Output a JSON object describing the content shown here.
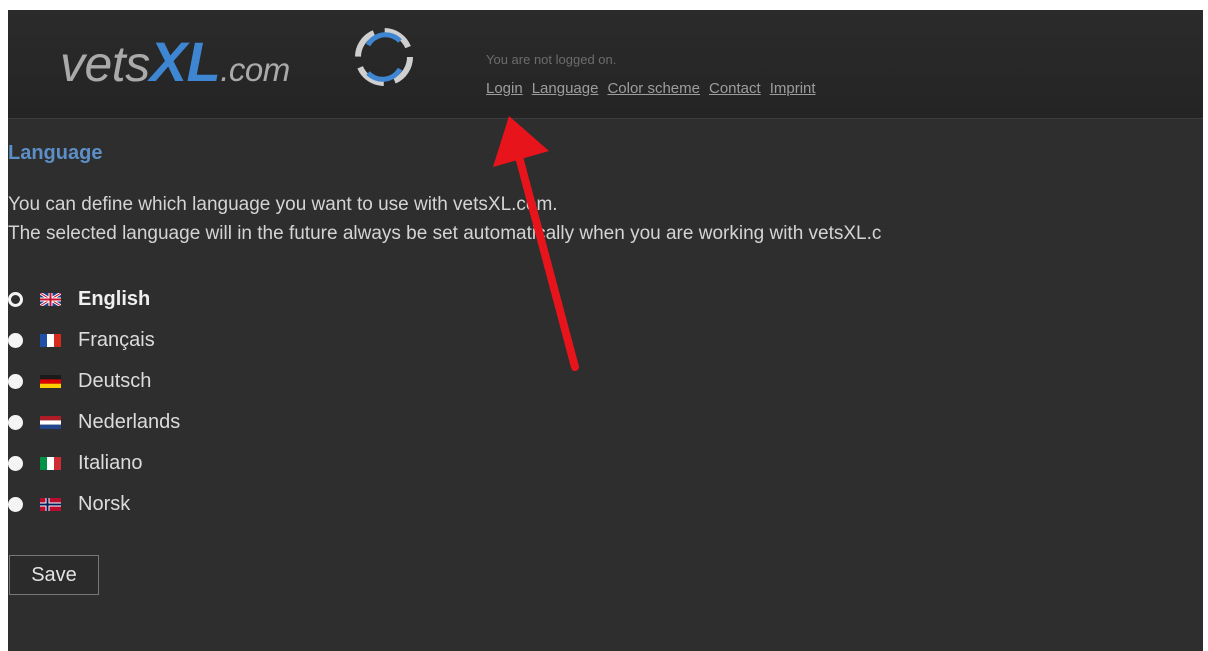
{
  "header": {
    "logo": {
      "part1": "vets",
      "part2": "XL",
      "part3": ".com"
    },
    "status": "You are not logged on.",
    "nav": [
      "Login",
      "Language",
      "Color scheme",
      "Contact",
      "Imprint"
    ]
  },
  "page": {
    "title": "Language",
    "intro_line1": "You can define which language you want to use with vetsXL.com.",
    "intro_line2": "The selected language will in the future always be set automatically when you are working with vetsXL.c"
  },
  "languages": [
    {
      "label": "English",
      "selected": true,
      "flag": "uk-flag-icon"
    },
    {
      "label": "Français",
      "selected": false,
      "flag": "france-flag-icon"
    },
    {
      "label": "Deutsch",
      "selected": false,
      "flag": "germany-flag-icon"
    },
    {
      "label": "Nederlands",
      "selected": false,
      "flag": "netherlands-flag-icon"
    },
    {
      "label": "Italiano",
      "selected": false,
      "flag": "italy-flag-icon"
    },
    {
      "label": "Norsk",
      "selected": false,
      "flag": "norway-flag-icon"
    }
  ],
  "save_label": "Save",
  "colors": {
    "background": "#2e2e2e",
    "title": "#5c8fc7",
    "logo_accent": "#3f86d2",
    "annotation_arrow": "#e8141c"
  }
}
